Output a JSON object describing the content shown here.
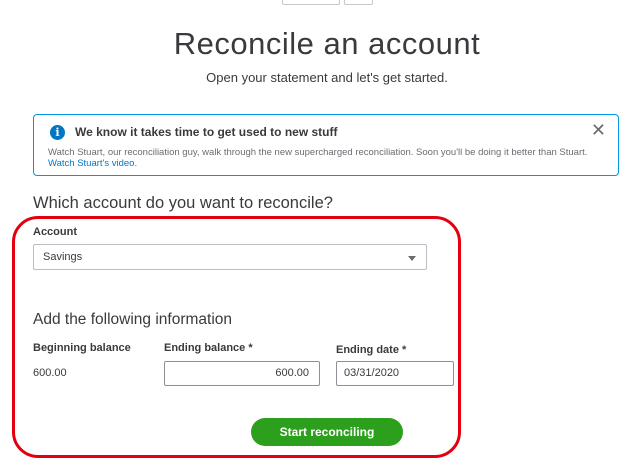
{
  "page": {
    "title": "Reconcile an account",
    "subtitle": "Open your statement and let's get started."
  },
  "banner": {
    "icon": "info-icon",
    "icon_glyph": "i",
    "heading": "We know it takes time to get used to new stuff",
    "body": "Watch Stuart, our reconciliation guy, walk through the new supercharged reconciliation. Soon you'll be doing it better than Stuart. ",
    "link_text": "Watch Stuart's video.",
    "close_glyph": "✕"
  },
  "form": {
    "question": "Which account do you want to reconcile?",
    "account_label": "Account",
    "account_value": "Savings",
    "info_heading": "Add the following information",
    "beginning_balance_label": "Beginning balance",
    "beginning_balance_value": "600.00",
    "ending_balance_label": "Ending balance *",
    "ending_balance_value": "600.00",
    "ending_date_label": "Ending date *",
    "ending_date_value": "03/31/2020",
    "start_button": "Start reconciling"
  },
  "colors": {
    "primary_button": "#2ca01c",
    "info_blue": "#0077c5",
    "banner_border": "#0097e6",
    "highlight_annotation": "#e4000f"
  }
}
